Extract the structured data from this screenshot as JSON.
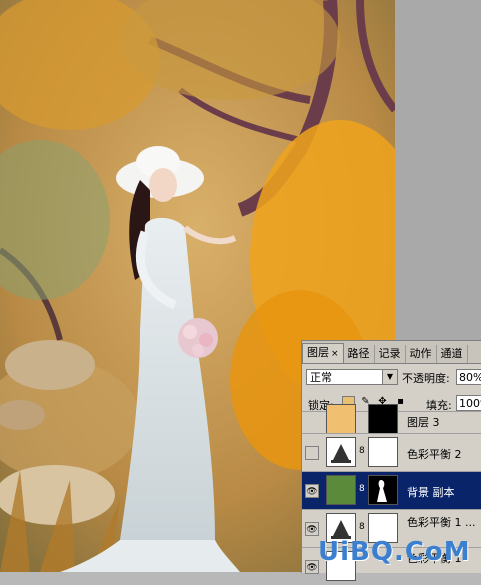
{
  "panel": {
    "tabs": [
      {
        "label": "图层",
        "active": true
      },
      {
        "label": "路径"
      },
      {
        "label": "记录"
      },
      {
        "label": "动作"
      },
      {
        "label": "通道"
      }
    ],
    "tab_close": "×",
    "blend_mode": "正常",
    "opacity_label": "不透明度:",
    "opacity_value": "80%",
    "lock_label": "锁定:",
    "fill_label": "填充:",
    "fill_value": "100%",
    "layers": [
      {
        "name": "图层 3",
        "visible": false,
        "selected": false
      },
      {
        "name": "色彩平衡 2",
        "visible": false,
        "selected": false
      },
      {
        "name": "背景 副本",
        "visible": true,
        "selected": true
      },
      {
        "name": "色彩平衡 1 ...",
        "visible": true,
        "selected": false
      },
      {
        "name": "色彩平衡 1",
        "visible": true,
        "selected": false
      }
    ]
  },
  "watermark": "UiBQ.CoM",
  "colors": {
    "selected_row": "#0a246a",
    "panel_bg": "#d4d0c8",
    "foliage": "#e8a12a"
  }
}
